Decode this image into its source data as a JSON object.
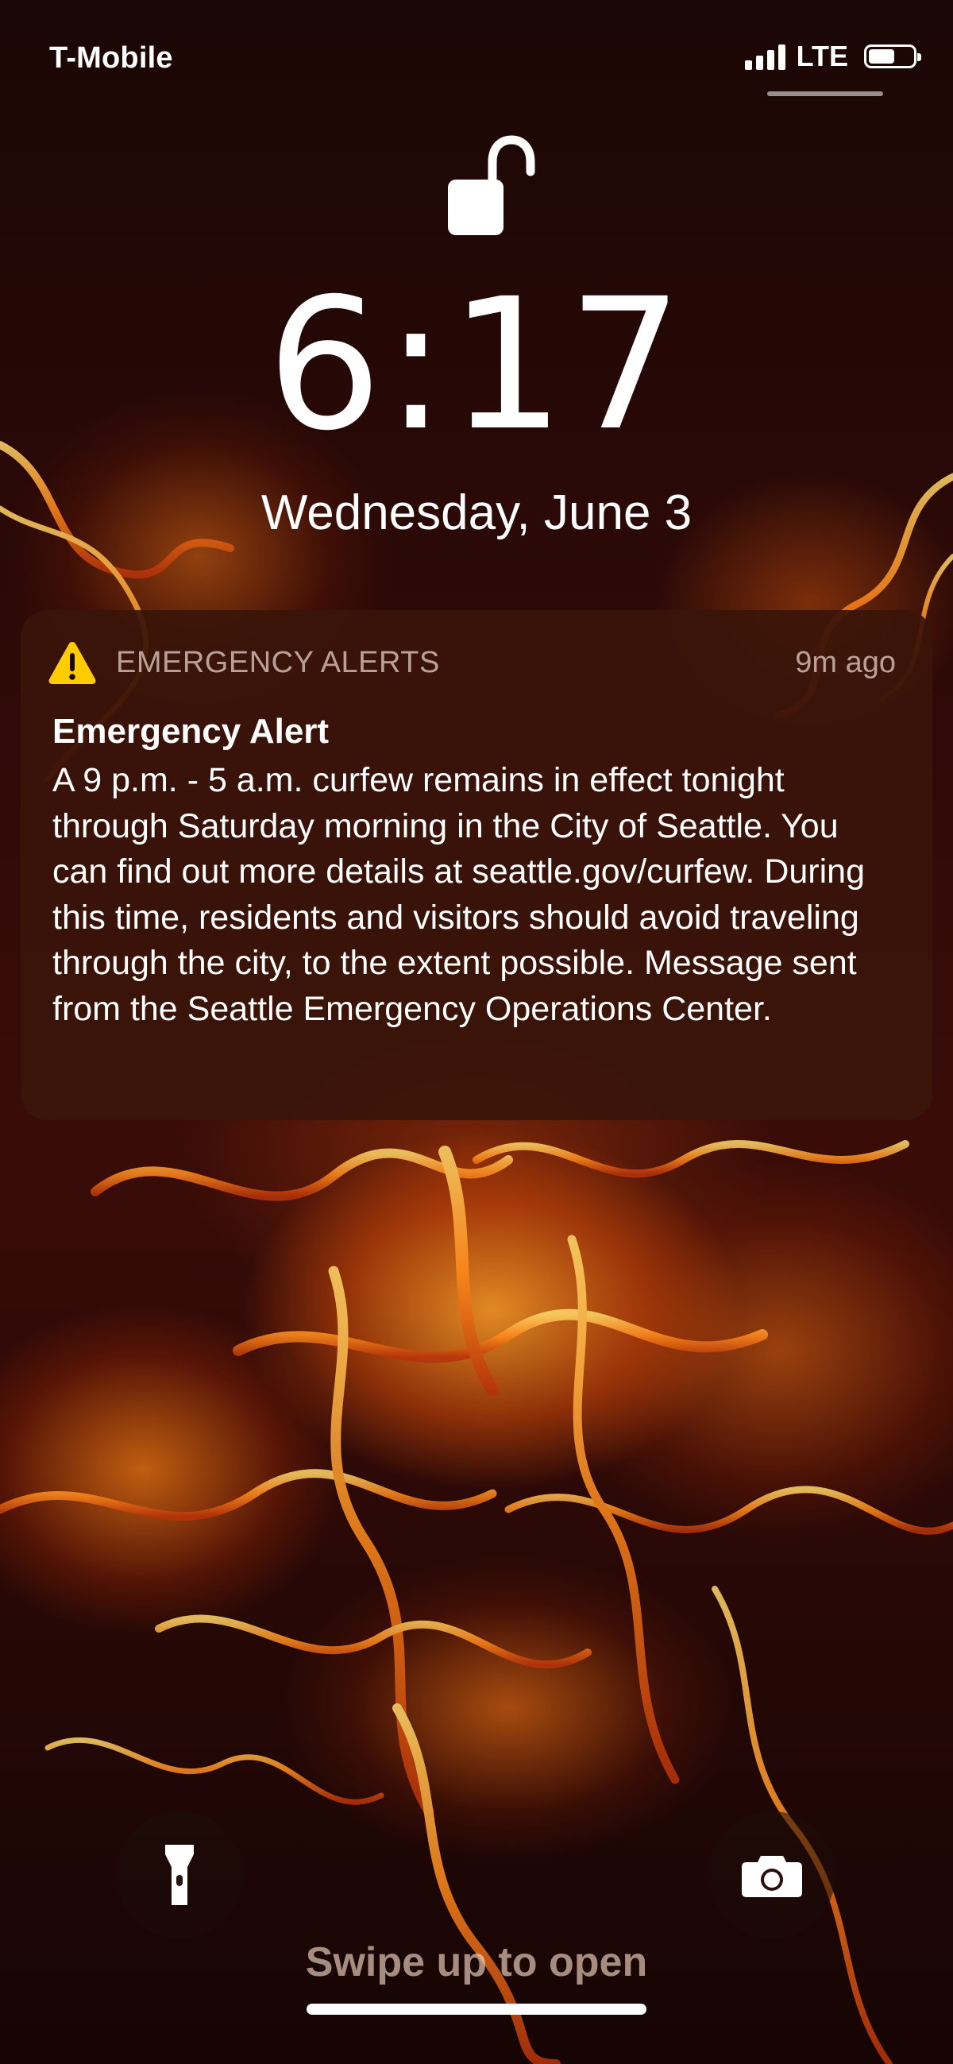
{
  "status_bar": {
    "carrier": "T-Mobile",
    "network": "LTE",
    "signal_bars": 4,
    "battery_level": 0.62
  },
  "lock_screen": {
    "lock_state": "unlocked",
    "time": "6:17",
    "date": "Wednesday, June 3"
  },
  "notification": {
    "app_name": "EMERGENCY ALERTS",
    "timestamp": "9m ago",
    "icon": "warning-triangle-icon",
    "title": "Emergency Alert",
    "body": "A 9 p.m. - 5 a.m. curfew remains in effect tonight through Saturday morning in the City of Seattle. You can find out more details at seattle.gov/curfew. During this time, residents and visitors should avoid traveling through the city, to the extent possible. Message sent from the Seattle Emergency Operations Center."
  },
  "quick_actions": {
    "left_icon": "flashlight-icon",
    "right_icon": "camera-icon"
  },
  "bottom": {
    "hint": "Swipe up to open"
  },
  "colors": {
    "warning_yellow": "#FFCC00",
    "card_background": "#3A140A",
    "text_white": "#FFFFFF"
  }
}
